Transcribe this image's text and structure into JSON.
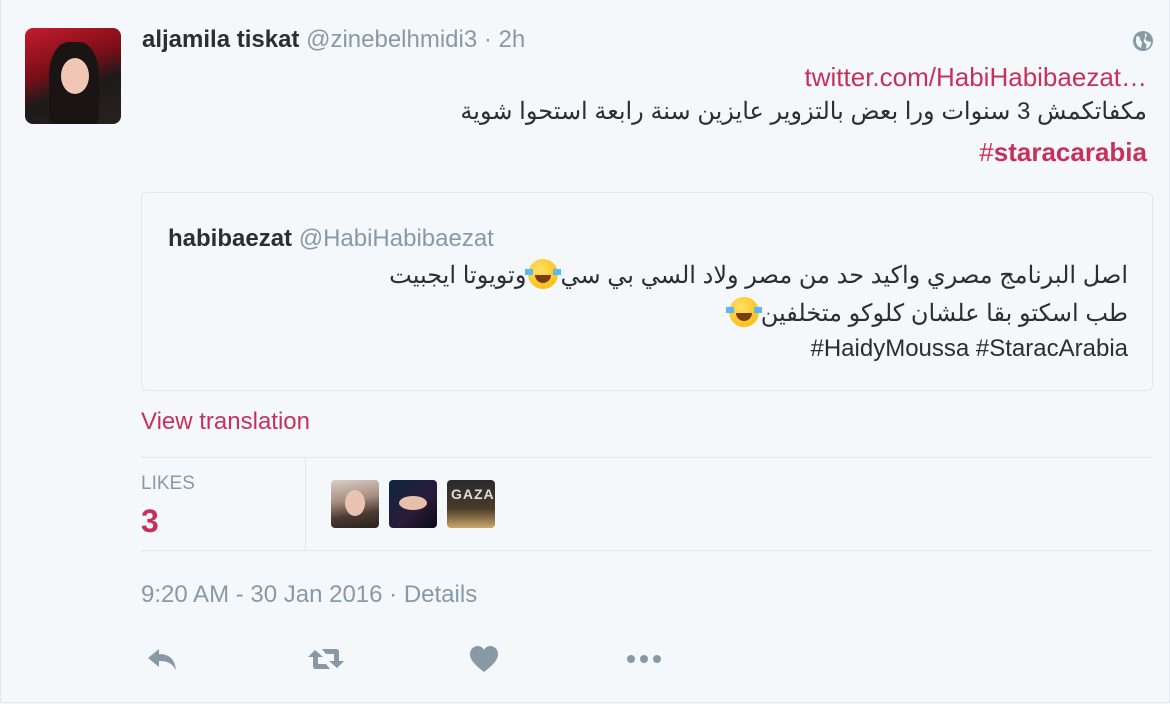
{
  "tweet": {
    "author_name": "aljamila tiskat",
    "author_handle": "@zinebelhmidi3",
    "time_ago": "· 2h",
    "link": "twitter.com/HabiHabibaezat…",
    "text": "مكفاتكمش 3 سنوات ورا بعض بالتزوير عايزين سنة رابعة استحوا شوية",
    "hashtag_symbol": "#",
    "hashtag": "staracarabia"
  },
  "quoted": {
    "name": "habibaezat",
    "handle": "@HabiHabibaezat",
    "line1_a": "اصل البرنامج مصري واكيد حد من مصر ولاد السي بي سي",
    "line1_b": "وتويوتا ايجبيت",
    "line2": "طب اسكتو بقا علشان كلوكو متخلفين",
    "line3": "#HaidyMoussa  #StaracArabia"
  },
  "view_translation": "View translation",
  "likes": {
    "label": "LIKES",
    "count": "3",
    "liker3_text": "GAZA"
  },
  "timestamp": "9:20 AM - 30 Jan 2016 · Details",
  "colors": {
    "accent": "#c8305c",
    "muted": "#8899a6",
    "text": "#292f33",
    "border": "#e1e8ed",
    "background": "#f5f8fa"
  },
  "icons": [
    "globe-icon",
    "reply-icon",
    "retweet-icon",
    "like-heart-icon",
    "more-dots-icon",
    "face-with-tears-of-joy-emoji"
  ]
}
